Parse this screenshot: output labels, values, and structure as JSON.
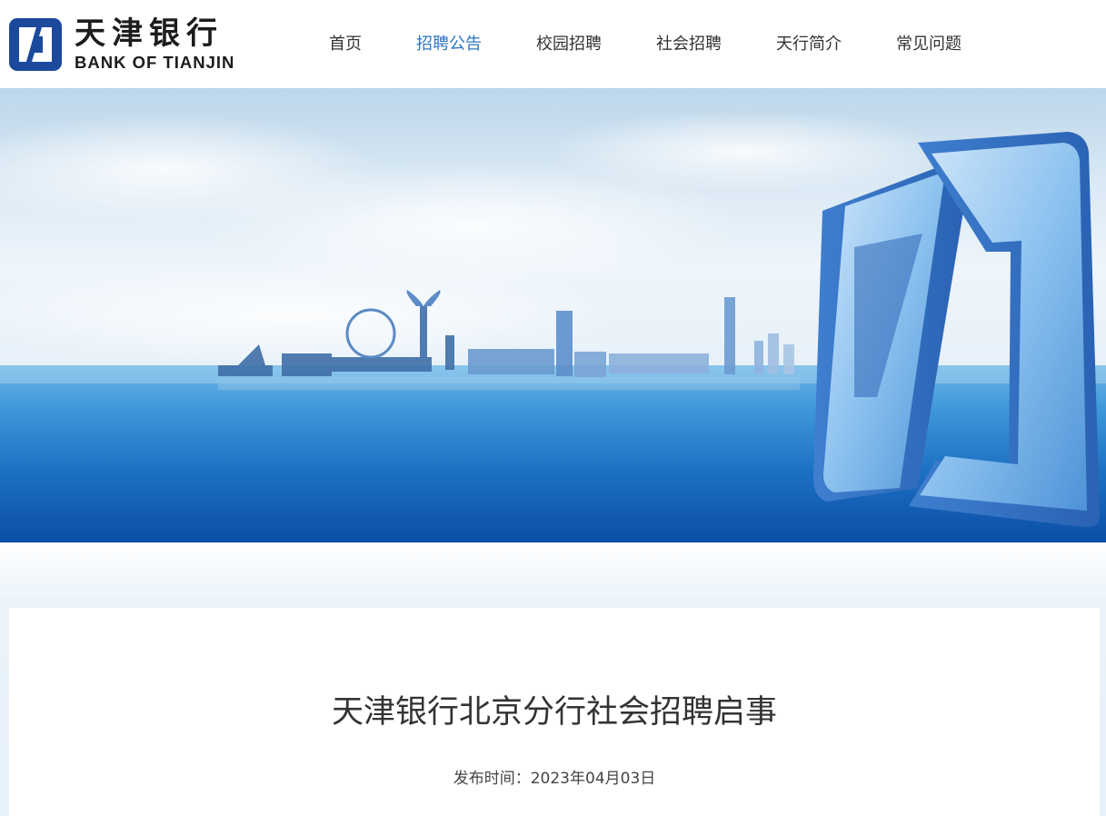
{
  "header": {
    "logo": {
      "name_cn": "天津银行",
      "name_en": "BANK OF TIANJIN",
      "brand_color": "#1b4a9c"
    },
    "nav": [
      {
        "label": "首页",
        "active": false
      },
      {
        "label": "招聘公告",
        "active": true
      },
      {
        "label": "校园招聘",
        "active": false
      },
      {
        "label": "社会招聘",
        "active": false
      },
      {
        "label": "天行简介",
        "active": false
      },
      {
        "label": "常见问题",
        "active": false
      }
    ],
    "active_color": "#2d77c2"
  },
  "banner": {
    "description_icon": "city-skyline-over-sea-with-logo-3d"
  },
  "article": {
    "title": "天津银行北京分行社会招聘启事",
    "publish_label": "发布时间：",
    "publish_date": "2023年04月03日"
  }
}
